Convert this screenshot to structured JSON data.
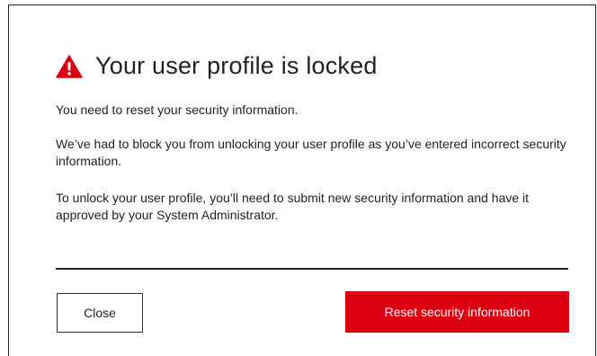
{
  "dialog": {
    "title": "Your user profile is locked",
    "icon": "warning-triangle-icon",
    "paragraphs": [
      "You need to reset your security information.",
      "We’ve had to block you from unlocking your user profile as you’ve entered incorrect security information.",
      "To unlock your user profile, you’ll need to submit new security information and have it approved by your System Administrator."
    ],
    "buttons": {
      "close_label": "Close",
      "reset_label": "Reset security information"
    }
  },
  "colors": {
    "accent": "#db0011",
    "text": "#222222",
    "border": "#222222"
  }
}
